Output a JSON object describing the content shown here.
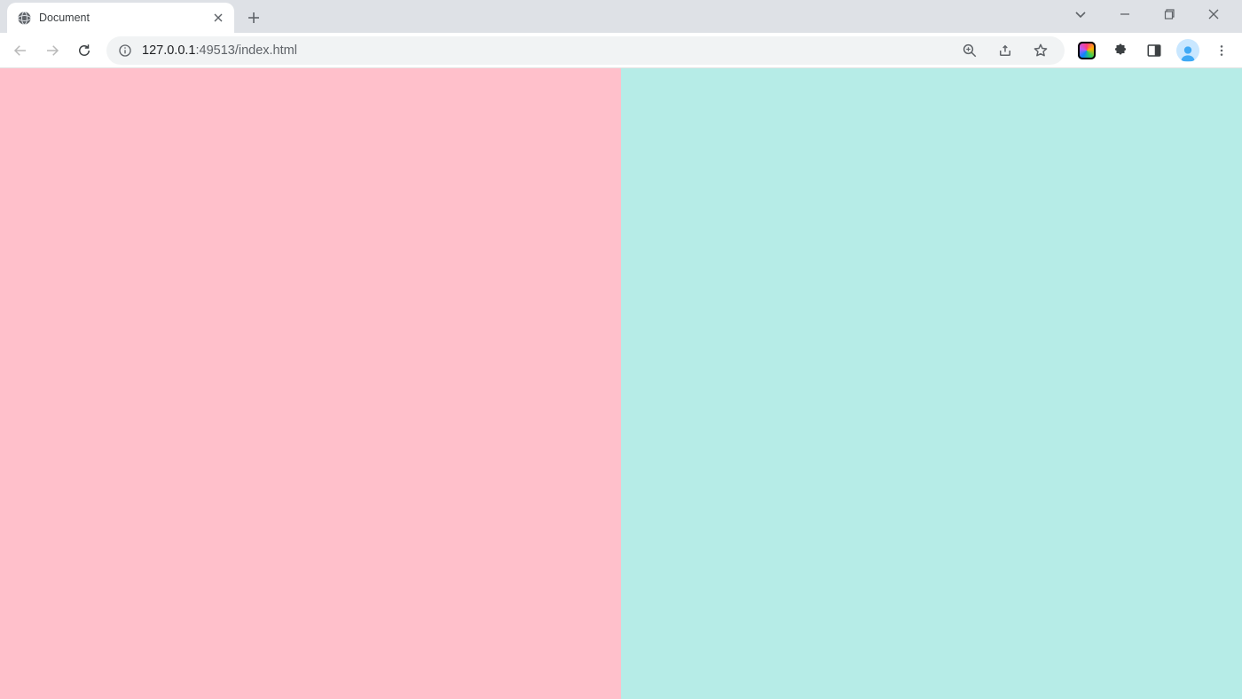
{
  "browser": {
    "tab_title": "Document",
    "url_host": "127.0.0.1",
    "url_rest": ":49513/index.html"
  },
  "content": {
    "left_color": "#ffc0cb",
    "right_color": "#b6ece7"
  }
}
